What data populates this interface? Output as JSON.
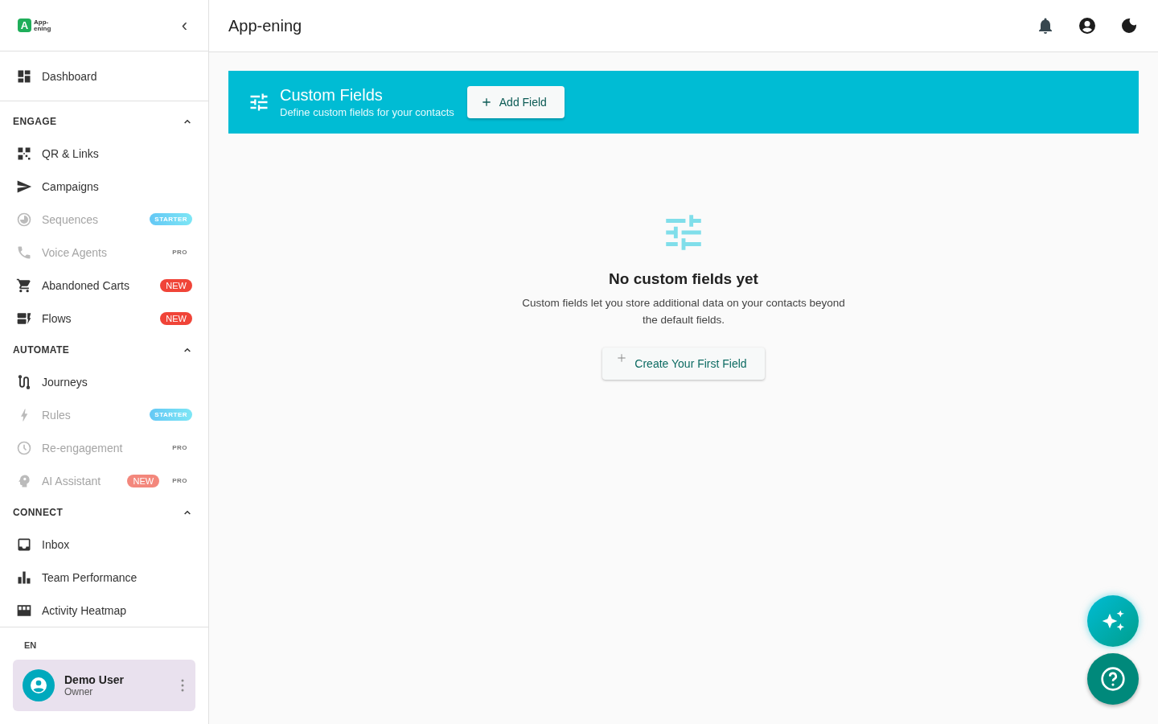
{
  "sidebar": {
    "logo_text": "App-\nening",
    "logo_letter": "A",
    "collapse_glyph": "‹",
    "top_items": [
      {
        "label": "Dashboard",
        "disabled": false
      }
    ],
    "sections": [
      {
        "title": "ENGAGE",
        "expanded": true,
        "items": [
          {
            "label": "QR & Links",
            "disabled": false
          },
          {
            "label": "Campaigns",
            "disabled": false
          },
          {
            "label": "Sequences",
            "disabled": true,
            "badges": [
              {
                "kind": "starter",
                "text": "STARTER"
              }
            ]
          },
          {
            "label": "Voice Agents",
            "disabled": true,
            "badges": [
              {
                "kind": "pro",
                "text": "PRO"
              }
            ]
          },
          {
            "label": "Abandoned Carts",
            "disabled": false,
            "badges": [
              {
                "kind": "new",
                "text": "NEW"
              }
            ]
          },
          {
            "label": "Flows",
            "disabled": false,
            "badges": [
              {
                "kind": "new",
                "text": "NEW"
              }
            ]
          }
        ]
      },
      {
        "title": "AUTOMATE",
        "expanded": true,
        "items": [
          {
            "label": "Journeys",
            "disabled": false
          },
          {
            "label": "Rules",
            "disabled": true,
            "badges": [
              {
                "kind": "starter",
                "text": "STARTER"
              }
            ]
          },
          {
            "label": "Re-engagement",
            "disabled": true,
            "badges": [
              {
                "kind": "pro",
                "text": "PRO"
              }
            ]
          },
          {
            "label": "AI Assistant",
            "disabled": true,
            "badges": [
              {
                "kind": "new",
                "text": "NEW"
              },
              {
                "kind": "pro",
                "text": "PRO"
              }
            ]
          }
        ]
      },
      {
        "title": "CONNECT",
        "expanded": true,
        "items": [
          {
            "label": "Inbox",
            "disabled": false
          },
          {
            "label": "Team Performance",
            "disabled": false
          },
          {
            "label": "Activity Heatmap",
            "disabled": false
          }
        ]
      }
    ],
    "language": "EN",
    "user": {
      "name": "Demo User",
      "role": "Owner"
    }
  },
  "header": {
    "title": "App-ening"
  },
  "banner": {
    "title": "Custom Fields",
    "subtitle": "Define custom fields for your contacts",
    "button": "Add Field"
  },
  "empty_state": {
    "title": "No custom fields yet",
    "text": "Custom fields let you store additional data on your contacts beyond the default fields.",
    "button": "Create Your First Field"
  }
}
